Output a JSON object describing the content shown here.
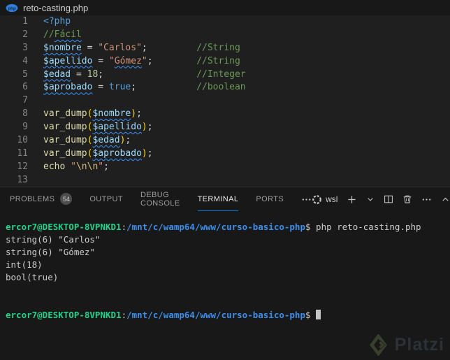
{
  "window": {
    "tab": {
      "filename": "reto-casting.php",
      "icon": "php-file-icon",
      "icon_text": "php"
    }
  },
  "colors": {
    "editor_bg": "#1f1f1f",
    "panel_bg": "#181818",
    "accent_underline": "#0078d4",
    "keyword": "#569cd6",
    "comment": "#6a9955",
    "variable": "#9cdcfe",
    "string": "#ce9178",
    "number": "#b5cea8",
    "function": "#dcdcaa",
    "escape": "#d7ba7d",
    "squiggle": "#3794ff",
    "terminal_green": "#23d18b",
    "terminal_blue": "#3b8eea",
    "terminal_fg": "#cccccc"
  },
  "editor": {
    "lines": [
      {
        "num": "1",
        "segs": [
          {
            "t": "<?php",
            "c": "kw"
          }
        ]
      },
      {
        "num": "2",
        "segs": [
          {
            "t": "//",
            "c": "com"
          },
          {
            "t": "Fácil",
            "c": "com",
            "sq": true
          }
        ]
      },
      {
        "num": "3",
        "segs": [
          {
            "t": "$nombre",
            "c": "var",
            "sq": true
          },
          {
            "t": " = ",
            "c": "op"
          },
          {
            "t": "\"Carlos\"",
            "c": "str"
          },
          {
            "t": ";",
            "c": "op"
          },
          {
            "t": "         ",
            "c": "op"
          },
          {
            "t": "//String",
            "c": "com"
          }
        ]
      },
      {
        "num": "4",
        "segs": [
          {
            "t": "$apellido",
            "c": "var",
            "sq": true
          },
          {
            "t": " = ",
            "c": "op"
          },
          {
            "t": "\"",
            "c": "str"
          },
          {
            "t": "Gómez",
            "c": "str",
            "sq": true
          },
          {
            "t": "\"",
            "c": "str"
          },
          {
            "t": ";",
            "c": "op"
          },
          {
            "t": "        ",
            "c": "op"
          },
          {
            "t": "//String",
            "c": "com"
          }
        ]
      },
      {
        "num": "5",
        "segs": [
          {
            "t": "$edad",
            "c": "var",
            "sq": true
          },
          {
            "t": " = ",
            "c": "op"
          },
          {
            "t": "18",
            "c": "num"
          },
          {
            "t": ";",
            "c": "op"
          },
          {
            "t": "                 ",
            "c": "op"
          },
          {
            "t": "//Integer",
            "c": "com"
          }
        ]
      },
      {
        "num": "6",
        "segs": [
          {
            "t": "$aprobado",
            "c": "var",
            "sq": true
          },
          {
            "t": " = ",
            "c": "op"
          },
          {
            "t": "true",
            "c": "kw"
          },
          {
            "t": ";",
            "c": "op"
          },
          {
            "t": "           ",
            "c": "op"
          },
          {
            "t": "//boolean",
            "c": "com"
          }
        ]
      },
      {
        "num": "7",
        "segs": []
      },
      {
        "num": "8",
        "segs": [
          {
            "t": "var_dump",
            "c": "fn"
          },
          {
            "t": "(",
            "c": "paren"
          },
          {
            "t": "$nombre",
            "c": "var",
            "sq": true
          },
          {
            "t": ")",
            "c": "paren"
          },
          {
            "t": ";",
            "c": "op"
          }
        ]
      },
      {
        "num": "9",
        "segs": [
          {
            "t": "var_dump",
            "c": "fn"
          },
          {
            "t": "(",
            "c": "paren"
          },
          {
            "t": "$apellido",
            "c": "var",
            "sq": true
          },
          {
            "t": ")",
            "c": "paren"
          },
          {
            "t": ";",
            "c": "op"
          }
        ]
      },
      {
        "num": "10",
        "segs": [
          {
            "t": "var_dump",
            "c": "fn"
          },
          {
            "t": "(",
            "c": "paren"
          },
          {
            "t": "$edad",
            "c": "var",
            "sq": true
          },
          {
            "t": ")",
            "c": "paren"
          },
          {
            "t": ";",
            "c": "op"
          }
        ]
      },
      {
        "num": "11",
        "segs": [
          {
            "t": "var_dump",
            "c": "fn"
          },
          {
            "t": "(",
            "c": "paren"
          },
          {
            "t": "$aprobado",
            "c": "var",
            "sq": true
          },
          {
            "t": ")",
            "c": "paren"
          },
          {
            "t": ";",
            "c": "op"
          }
        ]
      },
      {
        "num": "12",
        "segs": [
          {
            "t": "echo",
            "c": "fn"
          },
          {
            "t": " ",
            "c": "op"
          },
          {
            "t": "\"",
            "c": "str"
          },
          {
            "t": "\\n\\n",
            "c": "esc"
          },
          {
            "t": "\"",
            "c": "str"
          },
          {
            "t": ";",
            "c": "op"
          }
        ]
      },
      {
        "num": "13",
        "segs": []
      }
    ]
  },
  "panel": {
    "tabs": [
      {
        "label": "PROBLEMS",
        "badge": "54"
      },
      {
        "label": "OUTPUT"
      },
      {
        "label": "DEBUG CONSOLE"
      },
      {
        "label": "TERMINAL",
        "active": true
      },
      {
        "label": "PORTS"
      }
    ],
    "tabs_overflow_icon": "ellipsis-icon",
    "shell": {
      "icon": "shell-indicator-icon",
      "label": "wsl"
    },
    "actions": [
      {
        "icon": "plus-icon"
      },
      {
        "icon": "chevron-down-icon"
      },
      {
        "icon": "split-terminal-icon"
      },
      {
        "icon": "trash-icon"
      },
      {
        "icon": "ellipsis-icon"
      },
      {
        "icon": "chevron-up-icon"
      }
    ]
  },
  "terminal": {
    "lines": [
      {
        "segs": [
          {
            "t": "ercor7@DESKTOP-8VPNKD1",
            "c": "tgreen"
          },
          {
            "t": ":",
            "c": "tfg"
          },
          {
            "t": "/mnt/c/wamp64/www/curso-basico-php",
            "c": "tblue"
          },
          {
            "t": "$",
            "c": "tfg"
          },
          {
            "t": " php reto-casting.php",
            "c": "tfg"
          }
        ]
      },
      {
        "segs": [
          {
            "t": "string(6) \"Carlos\"",
            "c": "tfg"
          }
        ]
      },
      {
        "segs": [
          {
            "t": "string(6) \"Gómez\"",
            "c": "tfg"
          }
        ]
      },
      {
        "segs": [
          {
            "t": "int(18)",
            "c": "tfg"
          }
        ]
      },
      {
        "segs": [
          {
            "t": "bool(true)",
            "c": "tfg"
          }
        ]
      },
      {
        "segs": []
      },
      {
        "segs": []
      },
      {
        "segs": [
          {
            "t": "ercor7@DESKTOP-8VPNKD1",
            "c": "tgreen"
          },
          {
            "t": ":",
            "c": "tfg"
          },
          {
            "t": "/mnt/c/wamp64/www/curso-basico-php",
            "c": "tblue"
          },
          {
            "t": "$",
            "c": "tfg"
          },
          {
            "t": " ",
            "c": "tfg"
          }
        ],
        "cursor": true
      }
    ]
  },
  "watermark": {
    "brand": "Platzi",
    "logo": "platzi-logo-icon"
  }
}
